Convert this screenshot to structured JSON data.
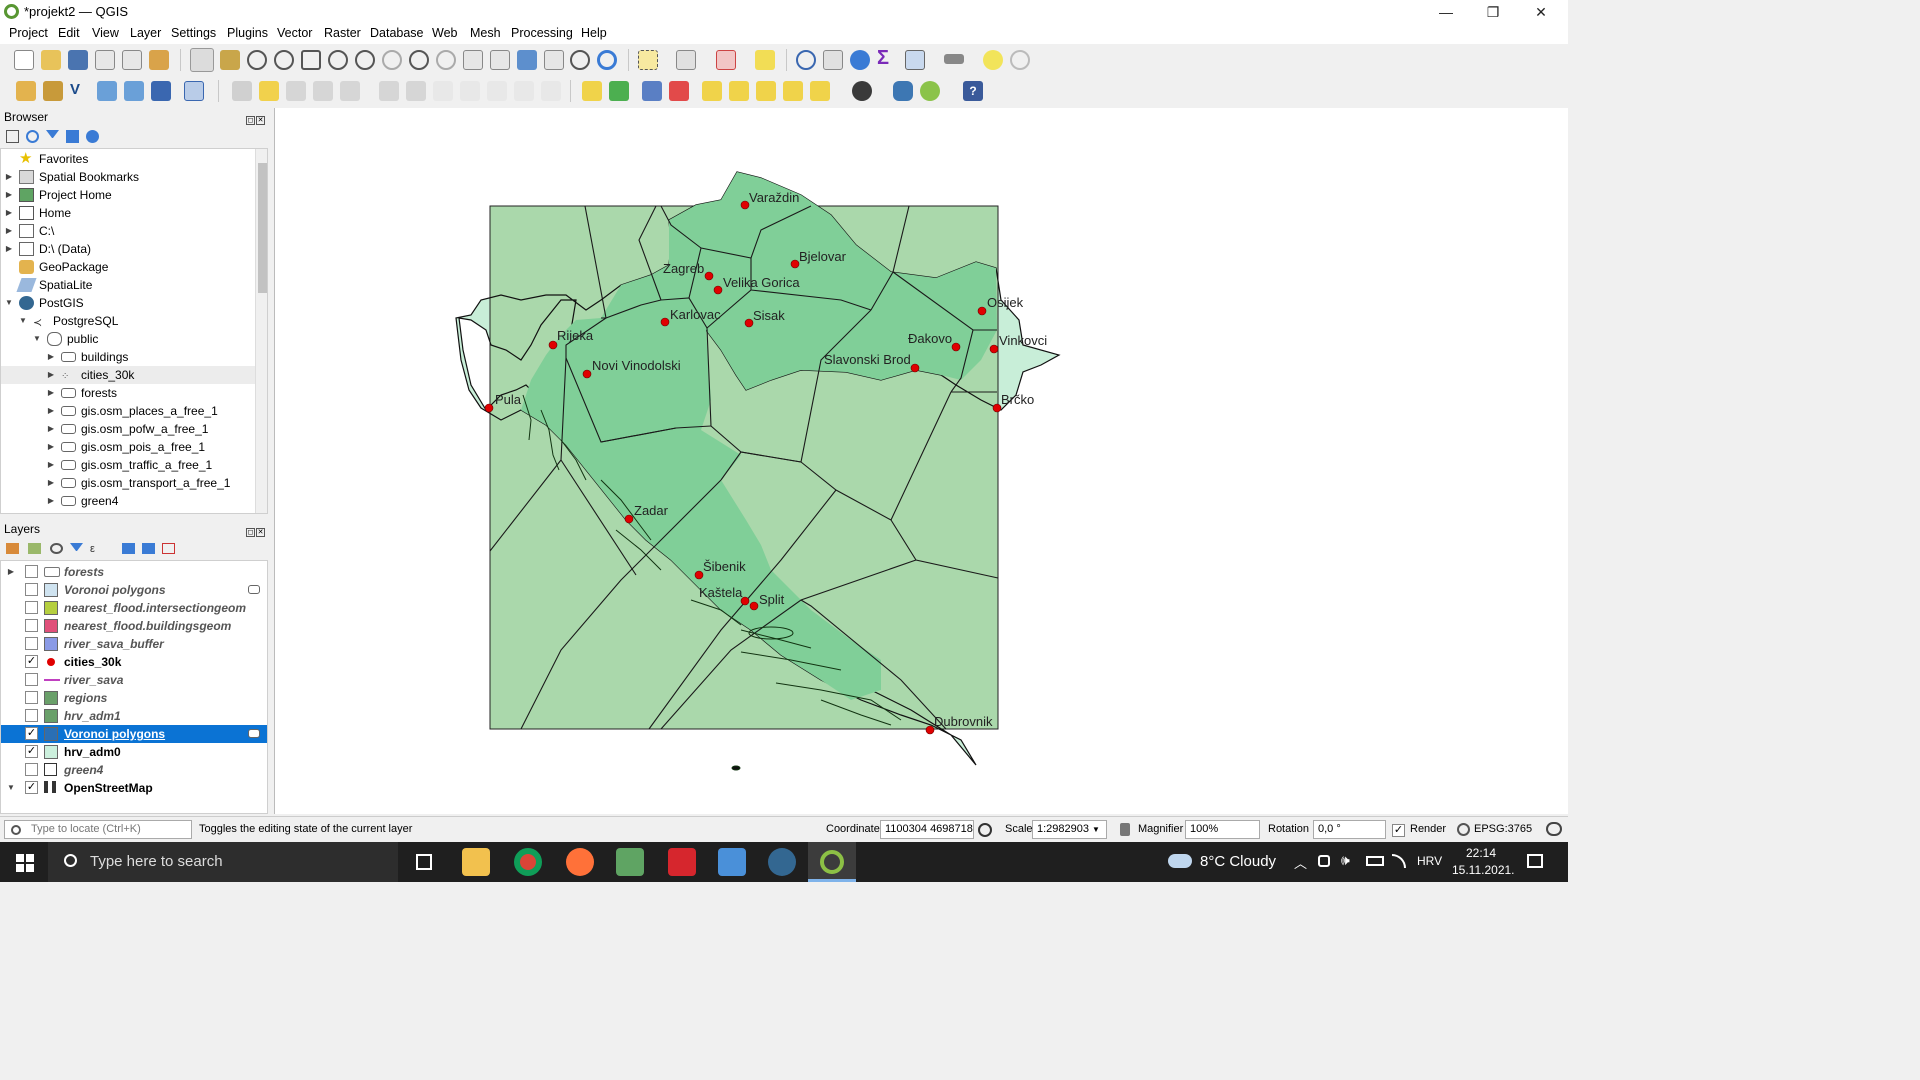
{
  "window": {
    "title": "*projekt2 — QGIS",
    "minimize": "—",
    "restore": "❐",
    "close": "✕"
  },
  "menu": [
    "Project",
    "Edit",
    "View",
    "Layer",
    "Settings",
    "Plugins",
    "Vector",
    "Raster",
    "Database",
    "Web",
    "Mesh",
    "Processing",
    "Help"
  ],
  "browser": {
    "title": "Browser",
    "items": [
      {
        "label": "Favorites",
        "icon": "star-icon",
        "level": 0,
        "arrow": ""
      },
      {
        "label": "Spatial Bookmarks",
        "icon": "bookmark-icon",
        "level": 0,
        "arrow": "▶"
      },
      {
        "label": "Project Home",
        "icon": "project-home-icon",
        "level": 0,
        "arrow": "▶"
      },
      {
        "label": "Home",
        "icon": "home-icon",
        "level": 0,
        "arrow": "▶"
      },
      {
        "label": "C:\\",
        "icon": "folder-icon",
        "level": 0,
        "arrow": "▶"
      },
      {
        "label": "D:\\ (Data)",
        "icon": "folder-icon",
        "level": 0,
        "arrow": "▶"
      },
      {
        "label": "GeoPackage",
        "icon": "geopackage-icon",
        "level": 0,
        "arrow": ""
      },
      {
        "label": "SpatiaLite",
        "icon": "spatialite-icon",
        "level": 0,
        "arrow": ""
      },
      {
        "label": "PostGIS",
        "icon": "postgis-icon",
        "level": 0,
        "arrow": "▼"
      },
      {
        "label": "PostgreSQL",
        "icon": "connection-icon",
        "level": 1,
        "arrow": "▼"
      },
      {
        "label": "public",
        "icon": "schema-icon",
        "level": 2,
        "arrow": "▼"
      },
      {
        "label": "buildings",
        "icon": "polygon-layer-icon",
        "level": 3,
        "arrow": "▶"
      },
      {
        "label": "cities_30k",
        "icon": "point-layer-icon",
        "level": 3,
        "arrow": "▶"
      },
      {
        "label": "forests",
        "icon": "polygon-layer-icon",
        "level": 3,
        "arrow": "▶"
      },
      {
        "label": "gis.osm_places_a_free_1",
        "icon": "polygon-layer-icon",
        "level": 3,
        "arrow": "▶"
      },
      {
        "label": "gis.osm_pofw_a_free_1",
        "icon": "polygon-layer-icon",
        "level": 3,
        "arrow": "▶"
      },
      {
        "label": "gis.osm_pois_a_free_1",
        "icon": "polygon-layer-icon",
        "level": 3,
        "arrow": "▶"
      },
      {
        "label": "gis.osm_traffic_a_free_1",
        "icon": "polygon-layer-icon",
        "level": 3,
        "arrow": "▶"
      },
      {
        "label": "gis.osm_transport_a_free_1",
        "icon": "polygon-layer-icon",
        "level": 3,
        "arrow": "▶"
      },
      {
        "label": "green4",
        "icon": "polygon-layer-icon",
        "level": 3,
        "arrow": "▶"
      }
    ],
    "highlighted_index": 12
  },
  "layers": {
    "title": "Layers",
    "items": [
      {
        "label": "forests",
        "checked": false,
        "symbol": "group",
        "color": "#ffffff",
        "arrow": "▶"
      },
      {
        "label": "Voronoi polygons",
        "checked": false,
        "symbol": "fill",
        "color": "#cfe3f0",
        "arrow": ""
      },
      {
        "label": "nearest_flood.intersectiongeom",
        "checked": false,
        "symbol": "fill",
        "color": "#b5cf3f",
        "arrow": ""
      },
      {
        "label": "nearest_flood.buildingsgeom",
        "checked": false,
        "symbol": "fill",
        "color": "#e0507a",
        "arrow": ""
      },
      {
        "label": "river_sava_buffer",
        "checked": false,
        "symbol": "fill",
        "color": "#8a9ae6",
        "arrow": ""
      },
      {
        "label": "cities_30k",
        "checked": true,
        "symbol": "point",
        "color": "#e00000",
        "arrow": ""
      },
      {
        "label": "river_sava",
        "checked": false,
        "symbol": "line",
        "color": "#c040c0",
        "arrow": ""
      },
      {
        "label": "regions",
        "checked": false,
        "symbol": "fill",
        "color": "#6aa06a",
        "arrow": ""
      },
      {
        "label": "hrv_adm1",
        "checked": false,
        "symbol": "fill",
        "color": "#6aa06a",
        "arrow": ""
      },
      {
        "label": "Voronoi polygons",
        "checked": true,
        "symbol": "fill",
        "color": "#2a6fb5",
        "arrow": "",
        "selected": true
      },
      {
        "label": "hrv_adm0",
        "checked": true,
        "symbol": "fill",
        "color": "#ccf0dd",
        "arrow": ""
      },
      {
        "label": "green4",
        "checked": false,
        "symbol": "raster",
        "color": "#ffffff",
        "arrow": ""
      },
      {
        "label": "OpenStreetMap",
        "checked": true,
        "symbol": "tiles",
        "color": "#333333",
        "arrow": "▼"
      }
    ]
  },
  "map": {
    "voronoi_fill": "#aad8ab",
    "land_fill": "#80cf98",
    "country_fill": "#c8eed8",
    "point_color": "#e00000",
    "cities": [
      "Varaždin",
      "Bjelovar",
      "Zagreb",
      "Velika Gorica",
      "Karlovac",
      "Sisak",
      "Osijek",
      "Đakovo",
      "Vinkovci",
      "Slavonski Brod",
      "Rijeka",
      "Novi Vinodolski",
      "Pula",
      "Brčko",
      "Zadar",
      "Šibenik",
      "Kaštela",
      "Split",
      "Dubrovnik"
    ]
  },
  "status": {
    "locate_placeholder": "Type to locate (Ctrl+K)",
    "message": "Toggles the editing state of the current layer",
    "coordinate_label": "Coordinate",
    "coordinate": "1100304 4698718",
    "scale_label": "Scale",
    "scale": "1:2982903",
    "magnifier_label": "Magnifier",
    "magnifier": "100%",
    "rotation_label": "Rotation",
    "rotation": "0,0 °",
    "render_label": "Render",
    "crs": "EPSG:3765"
  },
  "taskbar": {
    "search_placeholder": "Type here to search",
    "weather": "8°C  Cloudy",
    "language": "HRV",
    "time": "22:14",
    "date": "15.11.2021."
  }
}
